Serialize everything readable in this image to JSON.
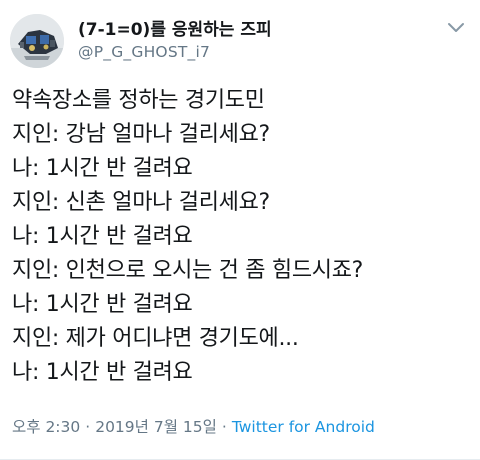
{
  "user": {
    "display_name": "(7-1=0)를 응원하는 즈피",
    "handle": "@P_G_GHOST_i7",
    "avatar_icon": "avatar-photo-icon"
  },
  "more_icon": "chevron-down-icon",
  "tweet": {
    "lines": [
      "약속장소를 정하는 경기도민",
      "지인: 강남 얼마나 걸리세요?",
      "나: 1시간 반 걸려요",
      "지인: 신촌 얼마나 걸리세요?",
      "나: 1시간 반 걸려요",
      "지인: 인천으로 오시는 건 좀 힘드시죠?",
      "나: 1시간 반 걸려요",
      "지인: 제가 어디냐면 경기도에...",
      "나: 1시간 반 걸려요"
    ],
    "time": "오후 2:30",
    "separator": "·",
    "date": "2019년 7월 15일",
    "source": "Twitter for Android"
  },
  "colors": {
    "text": "#14171a",
    "secondary": "#657786",
    "link": "#1b95e0"
  }
}
